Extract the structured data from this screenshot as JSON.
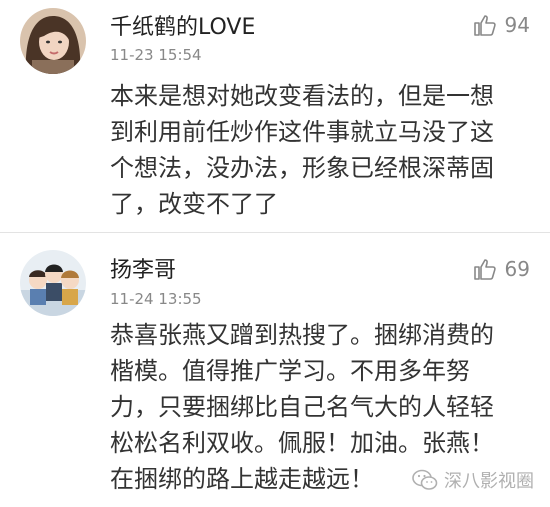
{
  "comments": [
    {
      "username": "千纸鹤的LOVE",
      "timestamp": "11-23 15:54",
      "likes": "94",
      "lines": [
        "本来是想对她改变看法的，但是一想",
        "到利用前任炒作这件事就立马没了这",
        "个想法，没办法，形象已经根深蒂固",
        "了，改变不了了"
      ],
      "avatar_icon": "avatar-girl-photo"
    },
    {
      "username": "扬李哥",
      "timestamp": "11-24 13:55",
      "likes": "69",
      "lines": [
        "恭喜张燕又蹭到热搜了。捆绑消费的",
        "楷模。值得推广学习。不用多年努",
        "力，只要捆绑比自己名气大的人轻轻",
        "松松名利双收。佩服！加油。张燕！",
        "在捆绑的路上越走越远！"
      ],
      "avatar_icon": "avatar-cartoon-group"
    }
  ],
  "watermark": {
    "text": "深八影视圈",
    "icon": "wechat-icon"
  },
  "colors": {
    "username": "#222222",
    "timestamp": "#888888",
    "body": "#333333",
    "divider": "#e3e3e3",
    "watermark": "#b0b0b0"
  }
}
